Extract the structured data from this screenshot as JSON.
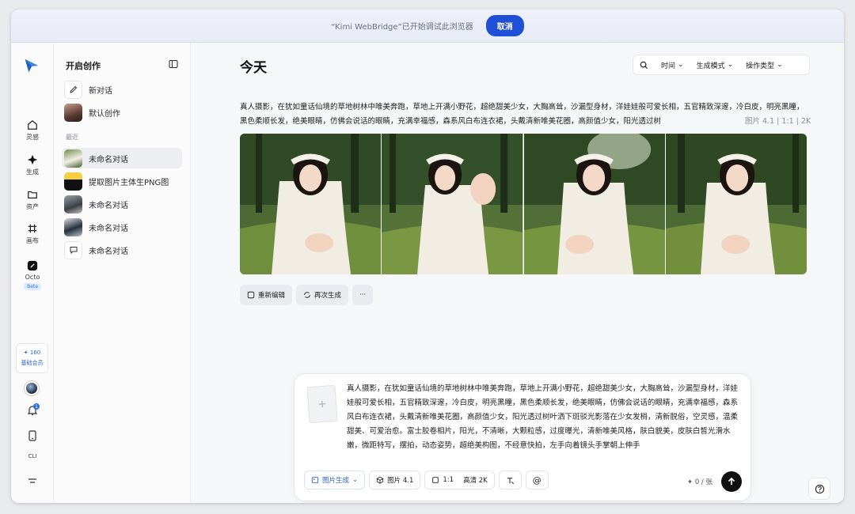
{
  "banner": {
    "text": "“Kimi WebBridge”已开始调试此浏览器",
    "cancel": "取消"
  },
  "rail": {
    "items": [
      {
        "label": "灵感",
        "icon": "home-icon"
      },
      {
        "label": "生成",
        "icon": "sparkle-icon"
      },
      {
        "label": "资产",
        "icon": "folder-icon"
      },
      {
        "label": "画布",
        "icon": "canvas-icon"
      },
      {
        "label": "Octo",
        "icon": "octo-icon",
        "badge": "Beta"
      }
    ],
    "credits": {
      "value": "✦ 160",
      "plan": "基础会员"
    },
    "notification_count": "1",
    "cli_label": "CLI"
  },
  "sidebar": {
    "header": "开启创作",
    "new_chat": "新对话",
    "default_creation": "默认创作",
    "section_recent": "最近",
    "recent": [
      {
        "label": "未命名对话",
        "active": true
      },
      {
        "label": "提取图片主体生PNG图",
        "active": false
      },
      {
        "label": "未命名对话",
        "active": false
      },
      {
        "label": "未命名对话",
        "active": false
      },
      {
        "label": "未命名对话",
        "active": false
      }
    ]
  },
  "main": {
    "title": "今天",
    "filters": {
      "time": "时间",
      "mode": "生成模式",
      "op": "操作类型"
    },
    "prompt": "真人摄影，在犹如童话仙境的草地树林中唯美奔跑，草地上开满小野花，超绝甜美少女，大胸高耸，沙漏型身材，洋娃娃般可爱长相，五官精致深邃，冷白皮，明亮黑瞳，黑色柔顺长发，绝美眼睛，仿佛会说话的眼睛，充满幸福感，森系风白布连衣裙，头戴清新唯美花圈，高颜值少女，阳光透过树",
    "meta": "图片 4.1  |  1:1  |  2K",
    "actions": {
      "reedit": "重新编辑",
      "regen": "再次生成",
      "more": "···"
    }
  },
  "composer": {
    "text": "真人摄影，在犹如童话仙境的草地树林中唯美奔跑，草地上开满小野花，超绝甜美少女，大胸高耸，沙漏型身材，洋娃娃般可爱长相，五官精致深邃，冷白皮，明亮黑瞳，黑色柔顺长发，绝美眼睛，仿佛会说话的眼睛，充满幸福感，森系风白布连衣裙，头戴清新唯美花圈，高颜值少女，阳光透过树叶洒下斑驳光影落在少女发梢，清新脱俗，空灵感，温柔甜美、可爱治愈。富士胶卷相片，阳光，不清晰，大颗粒感，过度曝光，清新唯美风格，肤白貌美，皮肤白皙光滑水嫩，微距特写，摆拍，动态姿势，超绝美构图，不经意快拍，左手向着镜头手掌朝上伸手",
    "mode": "图片生成",
    "model": "图片 4.1",
    "ratio": "1:1",
    "quality": "高清 2K",
    "credit": "✦ 0 / 张"
  },
  "colors": {
    "accent": "#1f4fd6",
    "active_row": "#eceef2"
  }
}
